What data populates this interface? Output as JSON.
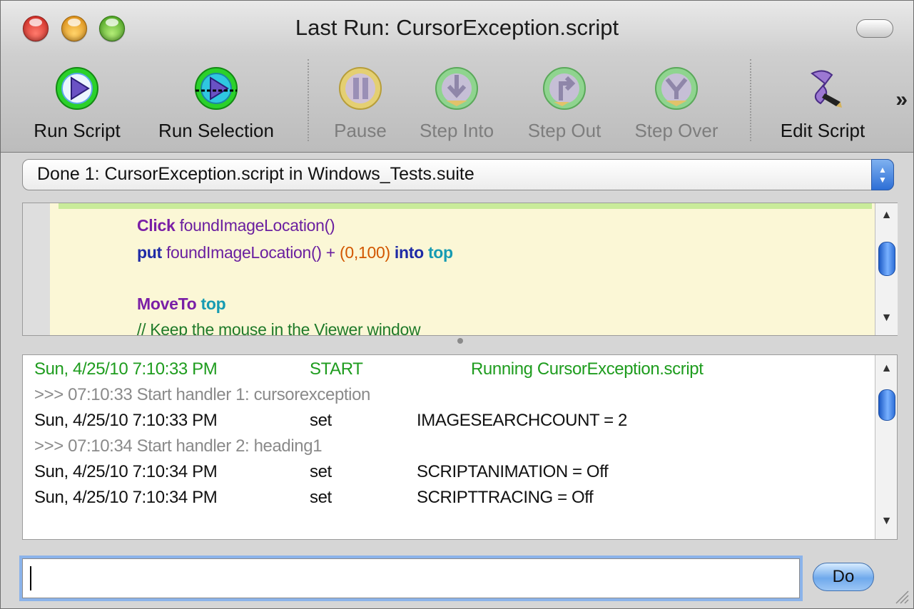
{
  "window": {
    "title": "Last Run: CursorException.script"
  },
  "toolbar": {
    "items": [
      {
        "label": "Run Script",
        "icon": "play-icon",
        "enabled": true
      },
      {
        "label": "Run Selection",
        "icon": "play-selection-icon",
        "enabled": true
      },
      {
        "label": "Pause",
        "icon": "pause-icon",
        "enabled": false
      },
      {
        "label": "Step Into",
        "icon": "step-into-icon",
        "enabled": false
      },
      {
        "label": "Step Out",
        "icon": "step-out-icon",
        "enabled": false
      },
      {
        "label": "Step Over",
        "icon": "step-over-icon",
        "enabled": false
      },
      {
        "label": "Edit Script",
        "icon": "edit-script-icon",
        "enabled": true
      }
    ],
    "overflow": "»"
  },
  "run_popup": {
    "selected": "Done 1: CursorException.script in Windows_Tests.suite"
  },
  "editor": {
    "lines": [
      [
        {
          "t": "Click",
          "c": "kw-p"
        },
        {
          "t": " foundImageLocation()",
          "c": "fn"
        }
      ],
      [
        {
          "t": "put",
          "c": "kw-b"
        },
        {
          "t": " foundImageLocation() + ",
          "c": "fn"
        },
        {
          "t": "(0,100)",
          "c": "num"
        },
        {
          "t": " into",
          "c": "kw-b"
        },
        {
          "t": " top",
          "c": "kw-t"
        }
      ],
      [],
      [
        {
          "t": "MoveTo",
          "c": "kw-p"
        },
        {
          "t": " top",
          "c": "kw-t"
        }
      ],
      [
        {
          "t": "// Keep the mouse in the Viewer window",
          "c": "cmt"
        }
      ]
    ]
  },
  "log": {
    "rows": [
      {
        "style": "green",
        "time": "Sun, 4/25/10 7:10:33 PM",
        "action": "START",
        "detail": "Running CursorException.script"
      },
      {
        "style": "gray",
        "full": ">>> 07:10:33 Start handler 1: cursorexception"
      },
      {
        "style": "black",
        "time": "Sun, 4/25/10 7:10:33 PM",
        "action": "set",
        "detail": "IMAGESEARCHCOUNT = 2"
      },
      {
        "style": "gray",
        "full": ">>> 07:10:34 Start handler 2: heading1"
      },
      {
        "style": "black",
        "time": "Sun, 4/25/10 7:10:34 PM",
        "action": "set",
        "detail": "SCRIPTANIMATION = Off"
      },
      {
        "style": "black",
        "time": "Sun, 4/25/10 7:10:34 PM",
        "action": "set",
        "detail": "SCRIPTTRACING = Off"
      }
    ]
  },
  "command": {
    "value": "",
    "button_label": "Do"
  }
}
